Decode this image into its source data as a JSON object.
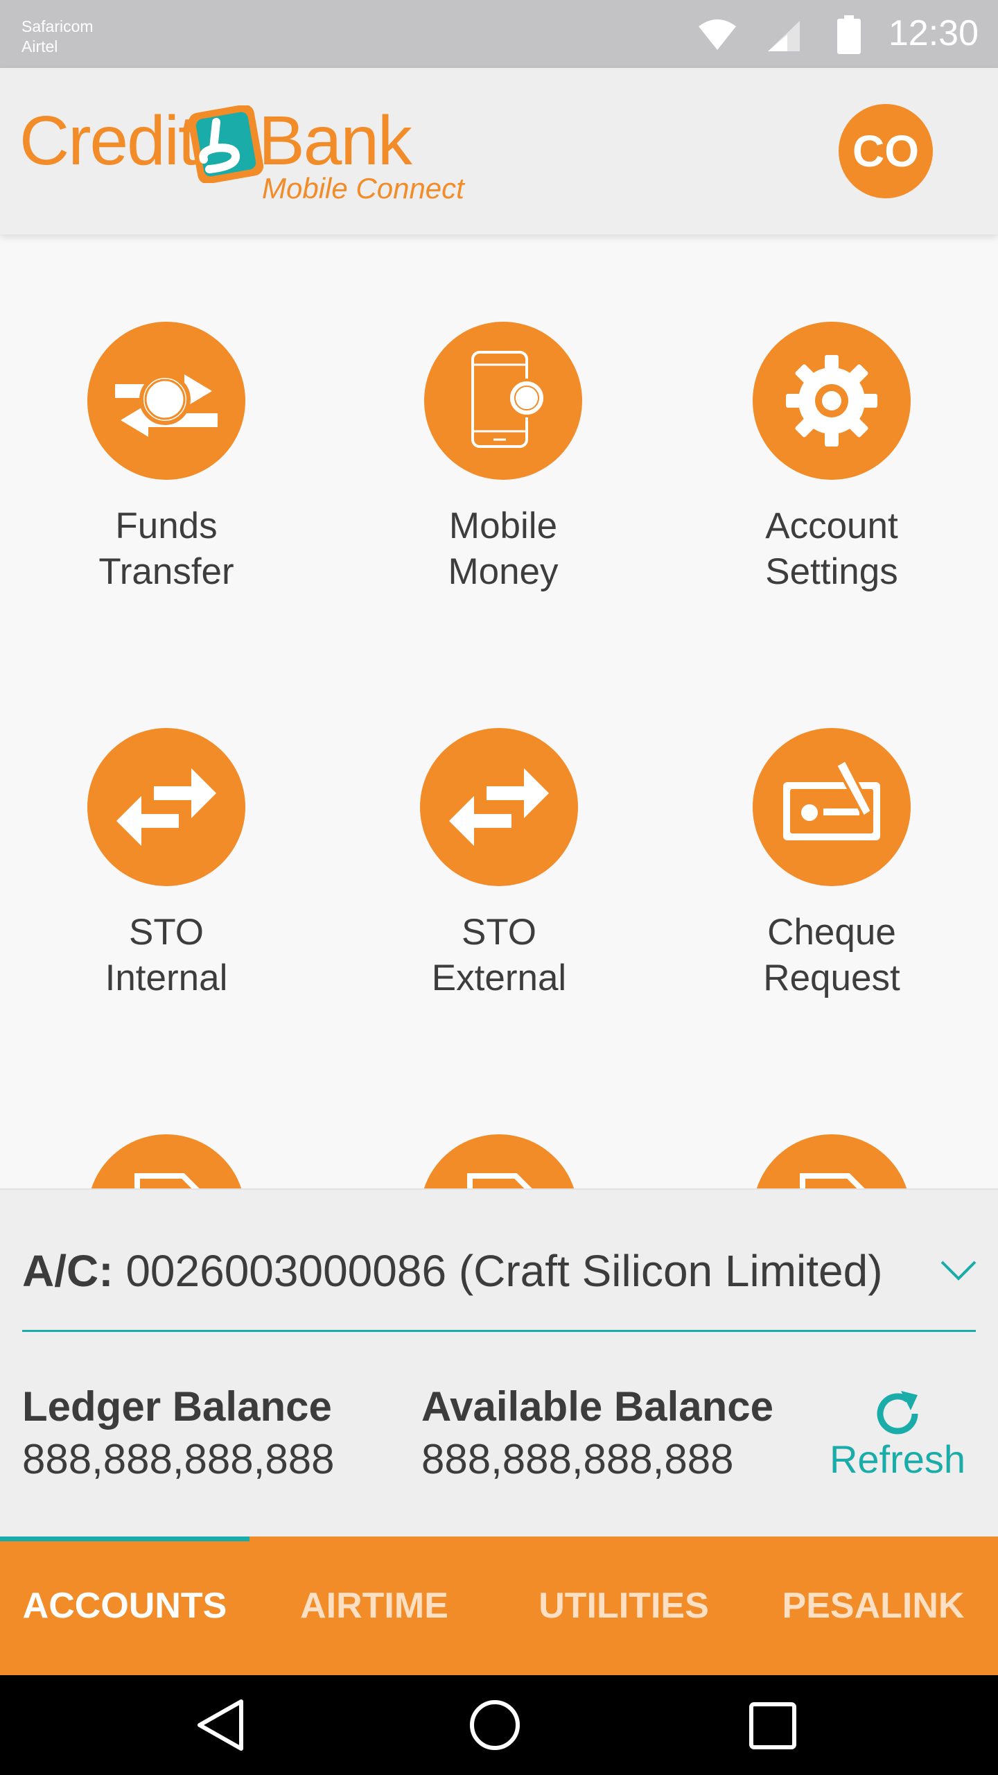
{
  "status_bar": {
    "carriers": [
      "Safaricom",
      "Airtel"
    ],
    "time": "12:30",
    "icons": [
      "wifi-icon",
      "signal-icon",
      "battery-icon"
    ]
  },
  "header": {
    "logo_word_left": "Credit",
    "logo_word_right": "Bank",
    "logo_tagline": "Mobile Connect",
    "avatar_initials": "CO"
  },
  "services": [
    {
      "label": "Funds\nTransfer",
      "icon": "funds-transfer-icon"
    },
    {
      "label": "Mobile\nMoney",
      "icon": "mobile-money-icon"
    },
    {
      "label": "Account\nSettings",
      "icon": "gear-icon"
    },
    {
      "label": "STO\nInternal",
      "icon": "swap-arrows-icon"
    },
    {
      "label": "STO\nExternal",
      "icon": "swap-arrows-icon"
    },
    {
      "label": "Cheque\nRequest",
      "icon": "cheque-icon"
    },
    {
      "label": "",
      "icon": "document-icon"
    },
    {
      "label": "",
      "icon": "document-icon"
    },
    {
      "label": "",
      "icon": "document-icon"
    }
  ],
  "account": {
    "label": "A/C:",
    "value": "0026003000086 (Craft Silicon Limited)",
    "ledger_label": "Ledger Balance",
    "ledger_value": "888,888,888,888",
    "available_label": "Available Balance",
    "available_value": "888,888,888,888",
    "refresh_label": "Refresh"
  },
  "tabs": [
    {
      "label": "ACCOUNTS",
      "active": true
    },
    {
      "label": "AIRTIME",
      "active": false
    },
    {
      "label": "UTILITIES",
      "active": false
    },
    {
      "label": "PESALINK",
      "active": false
    }
  ],
  "colors": {
    "brand_orange": "#f28c28",
    "accent_teal": "#1aaca8",
    "status_bar": "#c3c3c6",
    "header_bg": "#eeeeef"
  }
}
